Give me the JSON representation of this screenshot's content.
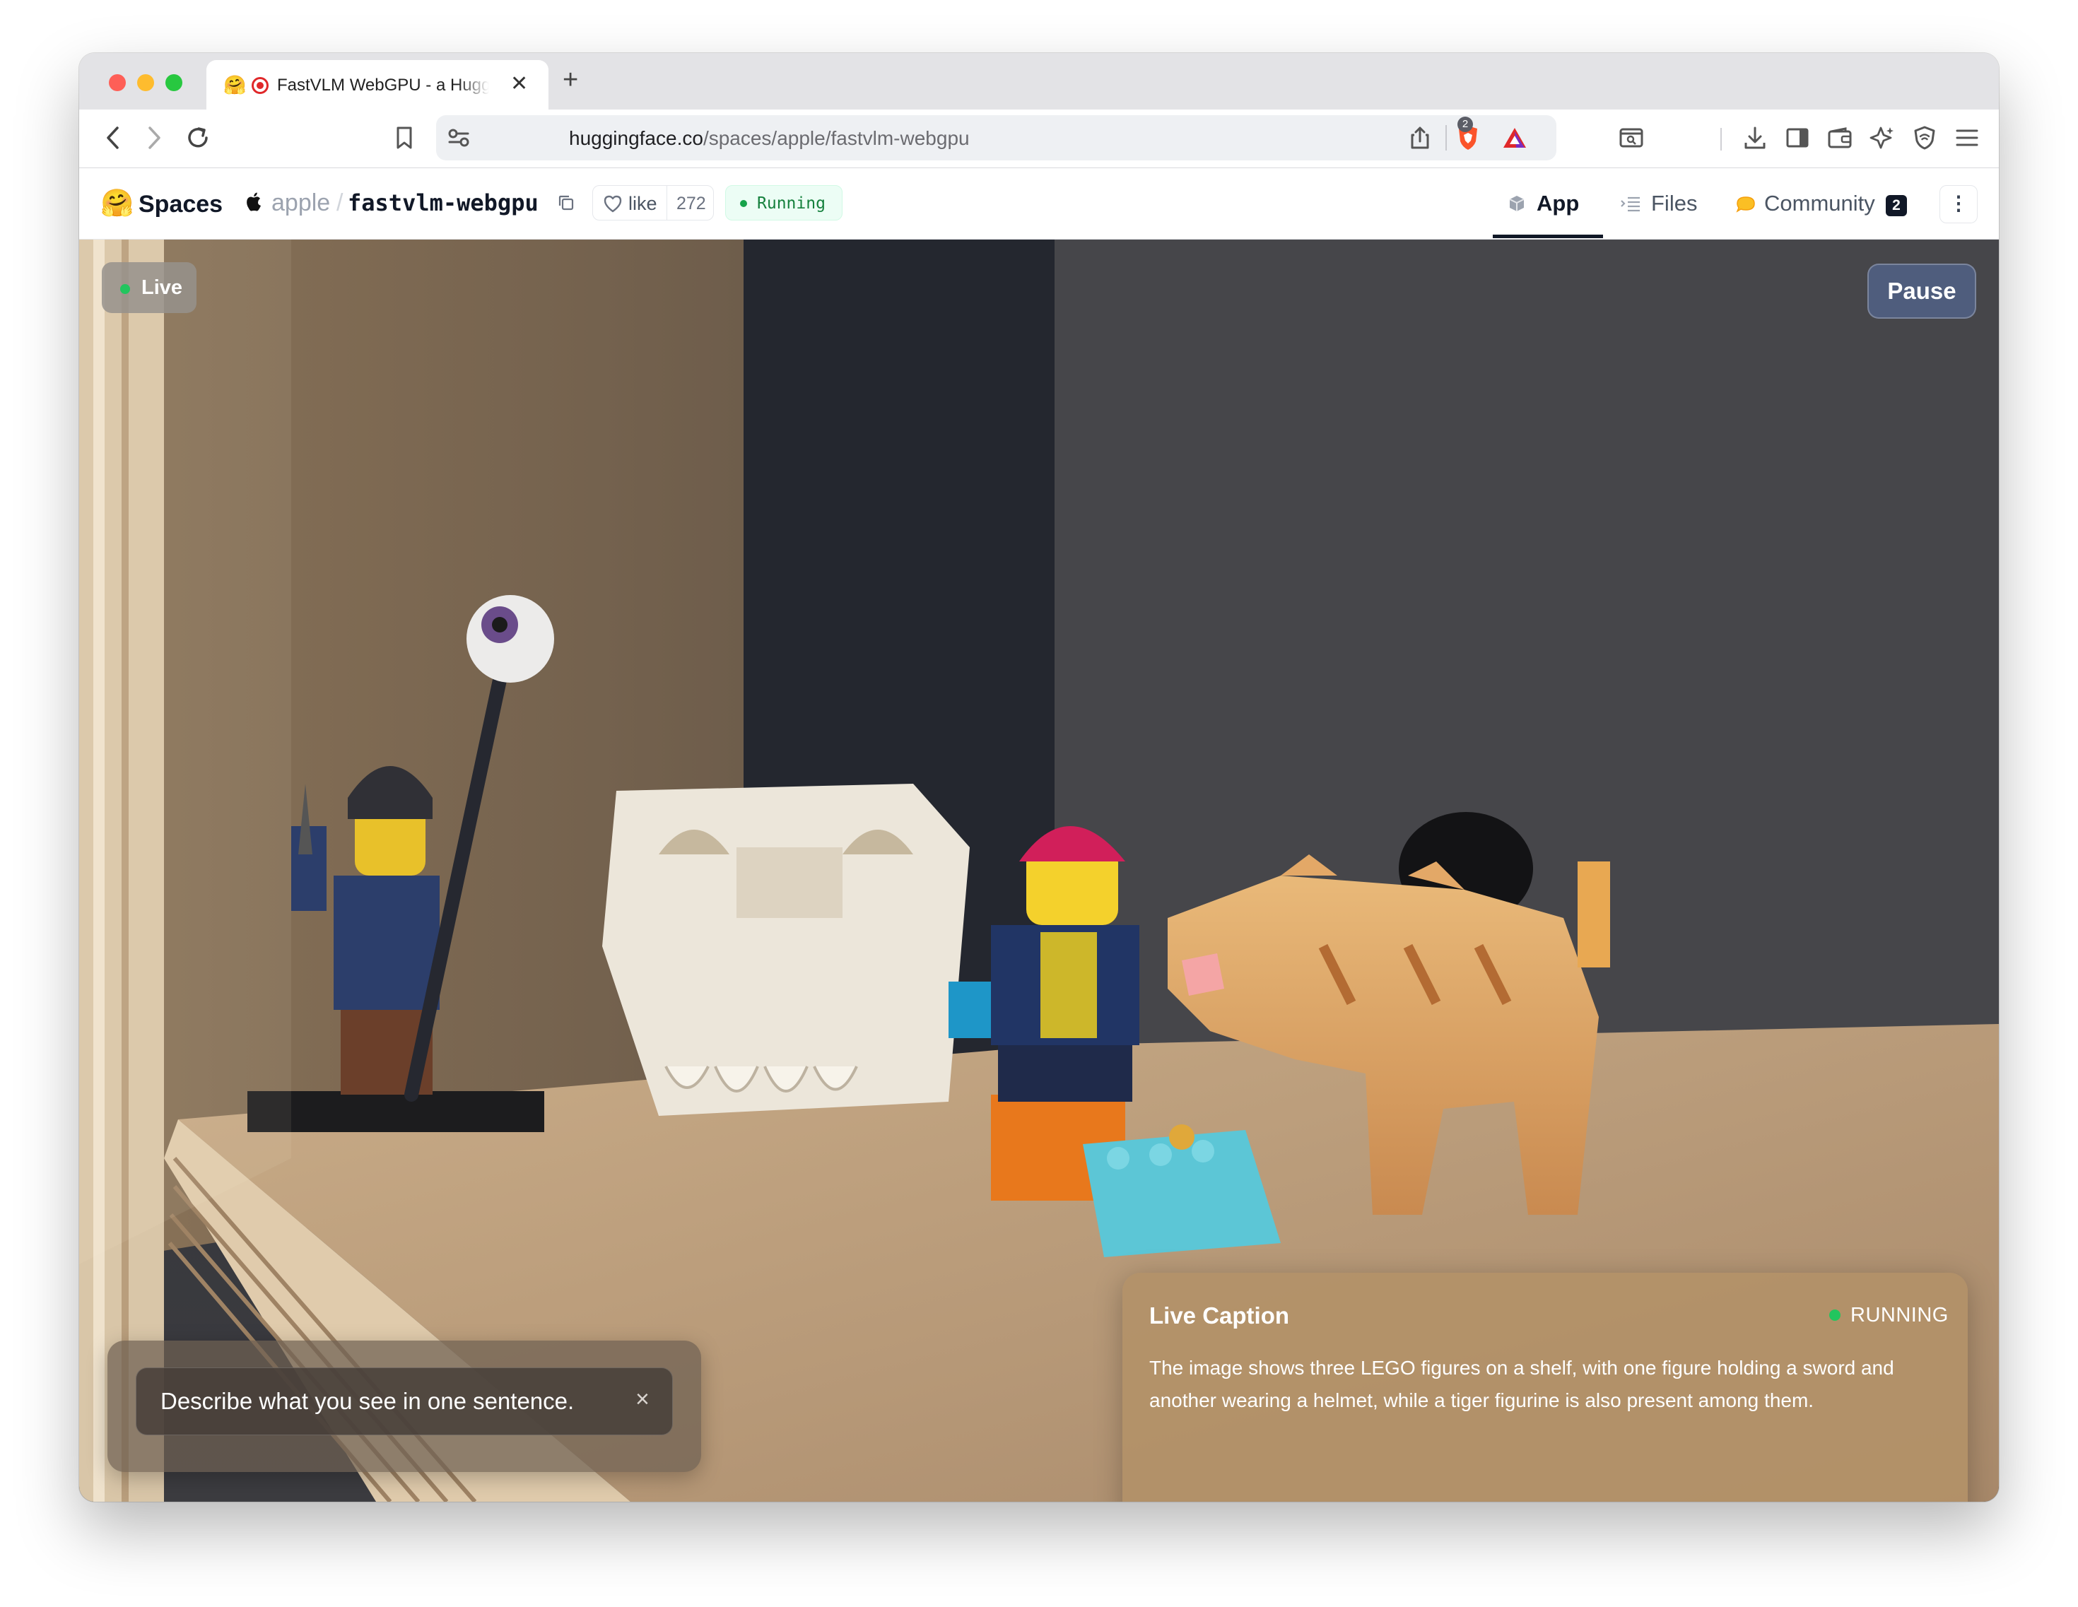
{
  "browser": {
    "tab": {
      "favicon": "hugging-face-emoji",
      "title": "FastVLM WebGPU - a Hugg",
      "recording": true
    },
    "new_tab": "+",
    "close": "✕",
    "url_host": "huggingface.co",
    "url_path": "/spaces/apple/fastvlm-webgpu",
    "shields_count": "2"
  },
  "hf_header": {
    "spaces_label": "Spaces",
    "owner": "apple",
    "separator": "/",
    "repo": "fastvlm-webgpu",
    "like_label": "like",
    "like_count": "272",
    "status": "Running",
    "tabs": [
      {
        "label": "App",
        "icon": "cube-icon",
        "active": true
      },
      {
        "label": "Files",
        "icon": "files-icon",
        "active": false
      },
      {
        "label": "Community",
        "icon": "community-icon",
        "badge": "2",
        "active": false
      }
    ],
    "more": "⋮"
  },
  "app": {
    "live_label": "Live",
    "pause_label": "Pause",
    "prompt_value": "Describe what you see in one sentence.",
    "prompt_clear": "×",
    "caption": {
      "title": "Live Caption",
      "status": "RUNNING",
      "text": "The image shows three LEGO figures on a shelf, with one figure holding a sword and another wearing a helmet, while a tiger figurine is also present among them."
    }
  },
  "colors": {
    "accent_green": "#22c55e",
    "pause_button": "#4f5d7d",
    "caption_panel": "#b29168"
  }
}
